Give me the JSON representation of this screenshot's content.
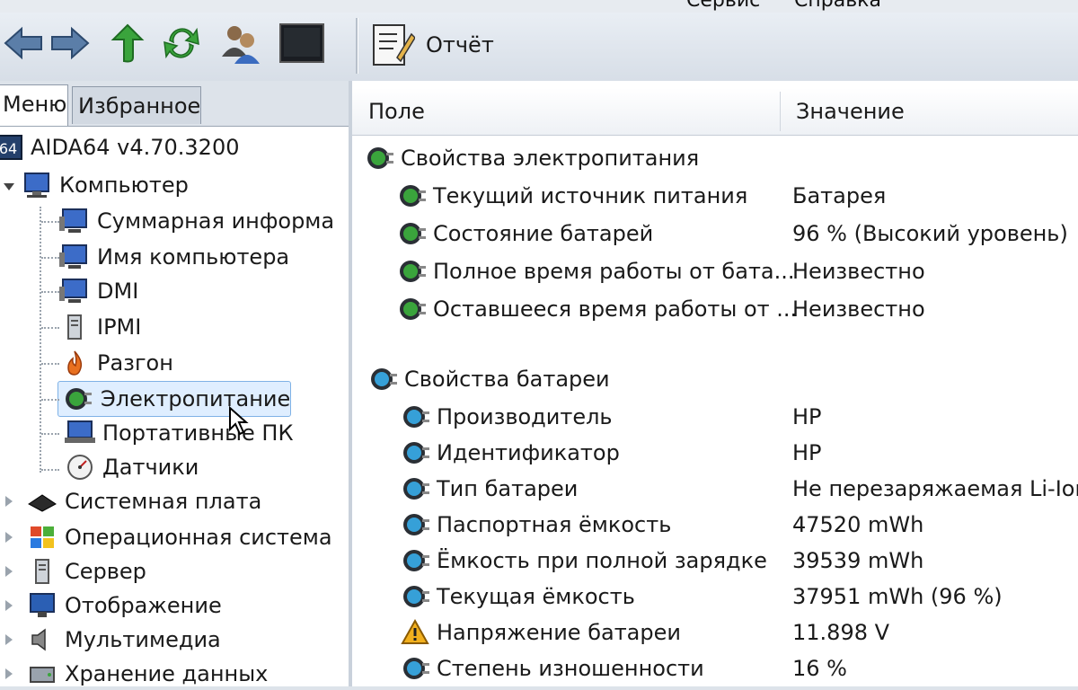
{
  "menu": {
    "items": [
      "",
      "",
      "",
      "",
      "Сервис",
      "Справка"
    ]
  },
  "toolbar": {
    "report_label": "Отчёт",
    "icons": [
      "back-arrow-icon",
      "forward-arrow-icon",
      "up-arrow-icon",
      "refresh-icon",
      "users-icon",
      "console-icon",
      "report-icon"
    ]
  },
  "left_panel": {
    "tabs": [
      {
        "label": "Меню",
        "active": true
      },
      {
        "label": "Избранное",
        "active": false
      }
    ],
    "tree": [
      {
        "label": "AIDA64 v4.70.3200",
        "icon": "aida64-icon"
      },
      {
        "label": "Компьютер",
        "icon": "computer-icon",
        "expanded": true
      },
      {
        "label": "Суммарная информа",
        "icon": "monitor-icon"
      },
      {
        "label": "Имя компьютера",
        "icon": "monitor-icon"
      },
      {
        "label": "DMI",
        "icon": "monitor-icon"
      },
      {
        "label": "IPMI",
        "icon": "server-icon"
      },
      {
        "label": "Разгон",
        "icon": "flame-icon"
      },
      {
        "label": "Электропитание",
        "icon": "power-plug-icon",
        "selected": true
      },
      {
        "label": "Портативные ПК",
        "icon": "laptop-icon"
      },
      {
        "label": "Датчики",
        "icon": "gauge-icon"
      },
      {
        "label": "Системная плата",
        "icon": "chip-icon"
      },
      {
        "label": "Операционная система",
        "icon": "windows-logo-icon"
      },
      {
        "label": "Сервер",
        "icon": "server-tower-icon"
      },
      {
        "label": "Отображение",
        "icon": "display-icon"
      },
      {
        "label": "Мультимедиа",
        "icon": "speaker-icon"
      },
      {
        "label": "Хранение данных",
        "icon": "storage-icon"
      }
    ]
  },
  "right_panel": {
    "columns": {
      "field": "Поле",
      "value": "Значение"
    },
    "sections": [
      {
        "title": "Свойства электропитания",
        "rows": [
          {
            "field": "Текущий источник питания",
            "value": "Батарея"
          },
          {
            "field": "Состояние батарей",
            "value": "96 % (Высокий уровень)"
          },
          {
            "field": "Полное время работы от бата...",
            "value": "Неизвестно"
          },
          {
            "field": "Оставшееся время работы от ...",
            "value": "Неизвестно"
          }
        ]
      },
      {
        "title": "Свойства батареи",
        "rows": [
          {
            "field": "Производитель",
            "value": "HP"
          },
          {
            "field": "Идентификатор",
            "value": "HP"
          },
          {
            "field": "Тип батареи",
            "value": "Не перезаряжаемая Li-Ion"
          },
          {
            "field": "Паспортная ёмкость",
            "value": "47520 mWh"
          },
          {
            "field": "Ёмкость при полной зарядке",
            "value": "39539 mWh"
          },
          {
            "field": "Текущая ёмкость",
            "value": "37951 mWh  (96 %)"
          },
          {
            "field": "Напряжение батареи",
            "value": "11.898 V",
            "warning": true
          },
          {
            "field": "Степень изношенности",
            "value": "16 %"
          }
        ]
      }
    ]
  },
  "colors": {
    "selection_bg": "#dfeeff",
    "selection_border": "#7fb2e6",
    "warning": "#f2b01e"
  }
}
